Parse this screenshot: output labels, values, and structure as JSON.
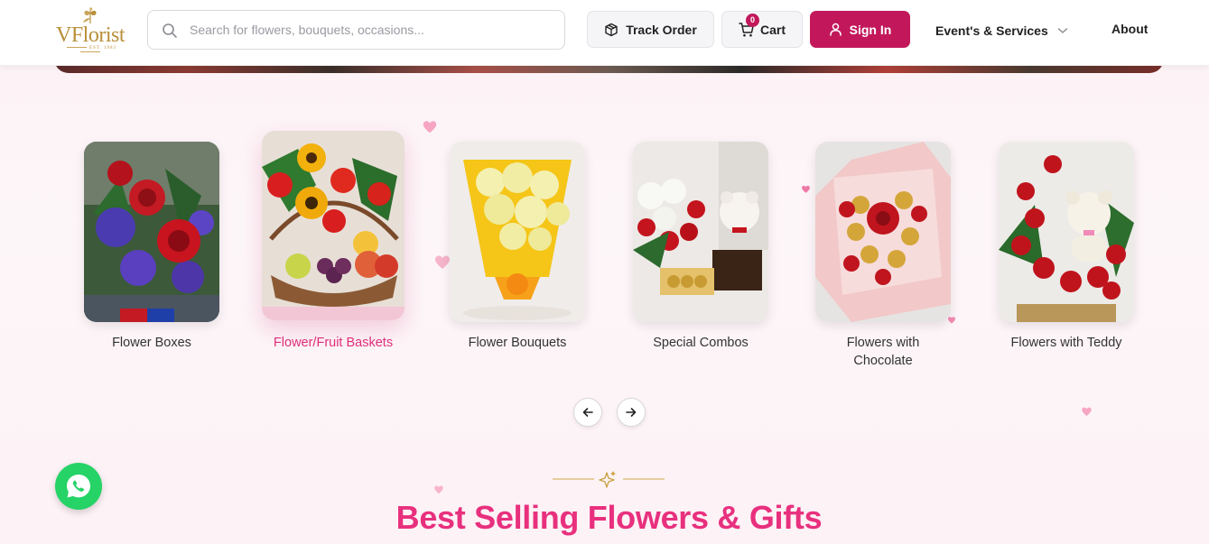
{
  "header": {
    "logo": {
      "name": "VFlorist",
      "tagline": "EST. 1983"
    },
    "search": {
      "placeholder": "Search for flowers, bouquets, occasions..."
    },
    "track_order_label": "Track Order",
    "cart_label": "Cart",
    "cart_count": "0",
    "sign_in_label": "Sign In",
    "nav": {
      "events_label": "Event's & Services",
      "about_label": "About"
    }
  },
  "categories": [
    {
      "label": "Flower Boxes",
      "active": false
    },
    {
      "label": "Flower/Fruit Baskets",
      "active": true
    },
    {
      "label": "Flower Bouquets",
      "active": false
    },
    {
      "label": "Special Combos",
      "active": false
    },
    {
      "label": "Flowers with\nChocolate",
      "active": false
    },
    {
      "label": "Flowers with Teddy",
      "active": false
    }
  ],
  "carousel": {
    "prev_icon": "arrow-left-icon",
    "next_icon": "arrow-right-icon"
  },
  "section": {
    "title": "Best Selling Flowers & Gifts",
    "ornament_icon": "sparkles-icon"
  },
  "colors": {
    "brand": "#c2185b",
    "accent": "#e8307e",
    "gold": "#b8903a",
    "whatsapp": "#25d366"
  }
}
